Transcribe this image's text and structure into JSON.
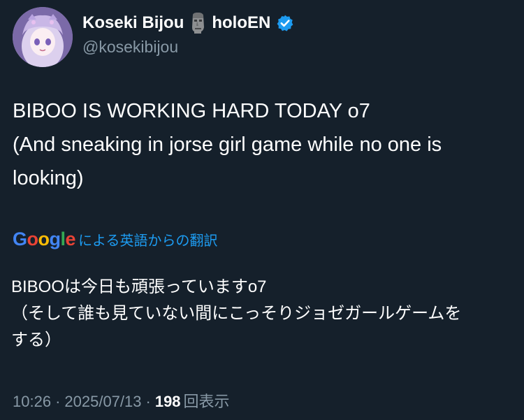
{
  "author": {
    "display_name": "Koseki Bijou",
    "display_suffix": "holoEN",
    "handle": "@kosekibijou",
    "name_emoji": "moai-icon",
    "verified_badge": "verified-icon",
    "verified_color": "#1d9bf0"
  },
  "tweet": {
    "lines": [
      "BIBOO IS WORKING HARD TODAY o7",
      "(And sneaking in jorse girl game while no one is",
      "looking)"
    ]
  },
  "translation": {
    "logo_letters": [
      "G",
      "o",
      "o",
      "g",
      "l",
      "e"
    ],
    "credit": "による英語からの翻訳",
    "lines": [
      "BIBOOは今日も頑張っていますo7",
      "（そして誰も見ていない間にこっそりジョゼガールゲームを",
      "する）"
    ]
  },
  "meta": {
    "time": "10:26",
    "separator": "·",
    "date": "2025/07/13",
    "views_count": "198",
    "views_label": "回表示"
  },
  "colors": {
    "background": "#15202b",
    "text": "#ffffff",
    "secondary": "#8899a6",
    "accent": "#1d9bf0"
  }
}
